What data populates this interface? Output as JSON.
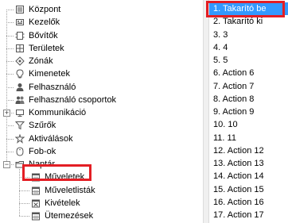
{
  "tree": {
    "items": [
      {
        "label": "Központ",
        "icon": "server-icon"
      },
      {
        "label": "Kezelők",
        "icon": "keypad-icon"
      },
      {
        "label": "Bővítők",
        "icon": "expander-module-icon"
      },
      {
        "label": "Területek",
        "icon": "area-icon"
      },
      {
        "label": "Zónák",
        "icon": "zone-icon"
      },
      {
        "label": "Kimenetek",
        "icon": "output-icon"
      },
      {
        "label": "Felhasználó",
        "icon": "user-icon"
      },
      {
        "label": "Felhasználó csoportok",
        "icon": "user-group-icon"
      },
      {
        "label": "Kommunikáció",
        "icon": "communication-icon"
      },
      {
        "label": "Szűrők",
        "icon": "filter-icon"
      },
      {
        "label": "Aktiválások",
        "icon": "activation-icon"
      },
      {
        "label": "Fob-ok",
        "icon": "fob-icon"
      },
      {
        "label": "Naptár",
        "icon": "folder-icon"
      },
      {
        "label": "Műveletek",
        "icon": "calendar-icon"
      },
      {
        "label": "Műveletlisták",
        "icon": "calendar-icon"
      },
      {
        "label": "Kivételek",
        "icon": "calendar-exception-icon"
      },
      {
        "label": "Ütemezések",
        "icon": "calendar-icon"
      }
    ]
  },
  "actions_list": {
    "items": [
      "1. Takarító be",
      "2. Takarító ki",
      "3. 3",
      "4. 4",
      "5. 5",
      "6. Action 6",
      "7. Action 7",
      "8. Action 8",
      "9. Action 9",
      "10. 10",
      "11. 11",
      "12. Action 12",
      "13. Action 13",
      "14. Action 14",
      "15. Action 15",
      "16. Action 16",
      "17. Action 17"
    ],
    "selected_index": 0
  },
  "colors": {
    "selection": "#3399ff",
    "highlight_box": "#e31e24"
  }
}
